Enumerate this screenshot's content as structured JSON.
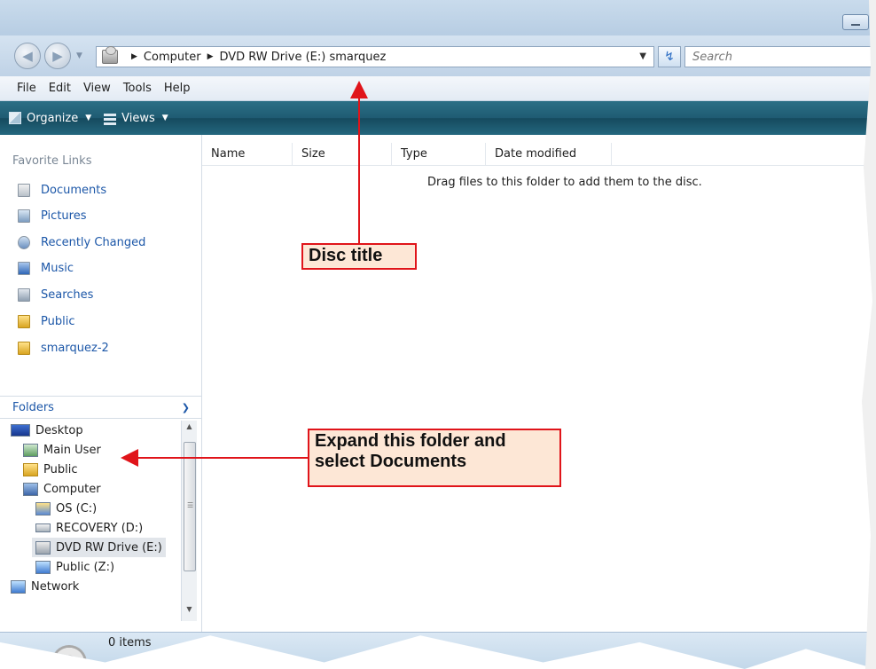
{
  "address_bar": {
    "crumbs": [
      "Computer",
      "DVD RW Drive (E:) smarquez"
    ],
    "search_placeholder": "Search"
  },
  "menubar": [
    "File",
    "Edit",
    "View",
    "Tools",
    "Help"
  ],
  "toolbar": {
    "organize": "Organize",
    "views": "Views"
  },
  "favorites": {
    "header": "Favorite Links",
    "items": [
      "Documents",
      "Pictures",
      "Recently Changed",
      "Music",
      "Searches",
      "Public",
      "smarquez-2"
    ]
  },
  "folders": {
    "label": "Folders",
    "tree": [
      "Desktop",
      "Main User",
      "Public",
      "Computer",
      "OS (C:)",
      "RECOVERY (D:)",
      "DVD RW Drive (E:)",
      "Public (Z:)",
      "Network"
    ],
    "selected": "DVD RW Drive (E:)"
  },
  "content": {
    "columns": [
      "Name",
      "Size",
      "Type",
      "Date modified"
    ],
    "empty_message": "Drag files to this folder to add them to the disc."
  },
  "status": {
    "items": "0 items"
  },
  "callouts": {
    "disc_title": "Disc title",
    "expand_line1": "Expand this folder and",
    "expand_line2": "select Documents"
  },
  "colors": {
    "callout_border": "#e0141a",
    "callout_fill": "#fde7d6",
    "toolbar": "#1f5b73",
    "link": "#1c57a8"
  }
}
